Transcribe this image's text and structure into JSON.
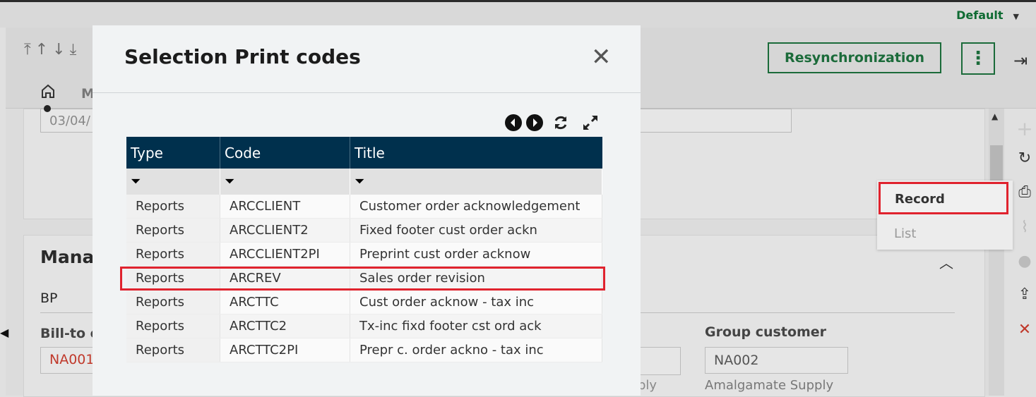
{
  "topbar": {
    "profile": "Default"
  },
  "header": {
    "resync_label": "Resynchronization",
    "nav_letter": "M"
  },
  "background": {
    "date_value": "03/04/",
    "section_title": "Manag",
    "bp_label": "BP",
    "billto_label": "Bill-to c",
    "billto_value": "NA001",
    "mid_desc": "ply",
    "group_label": "Group customer",
    "group_value": "NA002",
    "group_desc": "Amalgamate Supply"
  },
  "context_menu": {
    "items": [
      "Record",
      "List"
    ]
  },
  "modal": {
    "title": "Selection Print codes",
    "columns": [
      "Type",
      "Code",
      "Title"
    ],
    "rows": [
      {
        "type": "Reports",
        "code": "ARCCLIENT",
        "title": "Customer order acknowledgement"
      },
      {
        "type": "Reports",
        "code": "ARCCLIENT2",
        "title": "Fixed footer cust order ackn"
      },
      {
        "type": "Reports",
        "code": "ARCCLIENT2PI",
        "title": "Preprint cust order acknow"
      },
      {
        "type": "Reports",
        "code": "ARCREV",
        "title": "Sales order revision"
      },
      {
        "type": "Reports",
        "code": "ARCTTC",
        "title": "Cust order acknow - tax inc"
      },
      {
        "type": "Reports",
        "code": "ARCTTC2",
        "title": "Tx-inc fixd footer cst ord ack"
      },
      {
        "type": "Reports",
        "code": "ARCTTC2PI",
        "title": "Prepr c. order ackno - tax inc"
      }
    ],
    "highlighted_row": "ARCREV"
  },
  "colors": {
    "brand_green": "#1b6b3a",
    "grid_header": "#00304d",
    "highlight": "#e0232e"
  }
}
